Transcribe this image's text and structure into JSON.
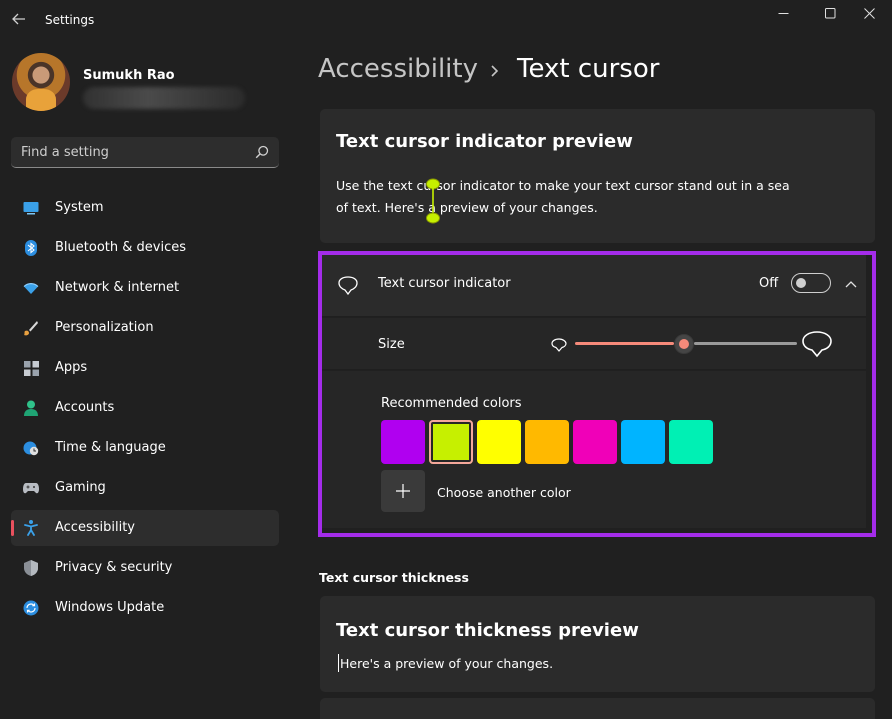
{
  "window": {
    "title": "Settings",
    "back_icon": "back-arrow-icon",
    "minimize_icon": "minimize-icon",
    "maximize_icon": "maximize-icon",
    "close_icon": "close-icon"
  },
  "profile": {
    "name": "Sumukh Rao"
  },
  "search": {
    "placeholder": "Find a setting",
    "value": "",
    "icon": "search-icon"
  },
  "sidebar": {
    "items": [
      {
        "label": "System",
        "icon": "system-icon",
        "active": false
      },
      {
        "label": "Bluetooth & devices",
        "icon": "bluetooth-icon",
        "active": false
      },
      {
        "label": "Network & internet",
        "icon": "wifi-icon",
        "active": false
      },
      {
        "label": "Personalization",
        "icon": "brush-icon",
        "active": false
      },
      {
        "label": "Apps",
        "icon": "apps-icon",
        "active": false
      },
      {
        "label": "Accounts",
        "icon": "person-icon",
        "active": false
      },
      {
        "label": "Time & language",
        "icon": "globe-clock-icon",
        "active": false
      },
      {
        "label": "Gaming",
        "icon": "gamepad-icon",
        "active": false
      },
      {
        "label": "Accessibility",
        "icon": "accessibility-icon",
        "active": true
      },
      {
        "label": "Privacy & security",
        "icon": "shield-icon",
        "active": false
      },
      {
        "label": "Windows Update",
        "icon": "update-icon",
        "active": false
      }
    ]
  },
  "breadcrumb": {
    "parent": "Accessibility",
    "current": "Text cursor"
  },
  "preview": {
    "title": "Text cursor indicator preview",
    "text": "Use the text cursor indicator to make your text cursor stand out in a sea of text. Here's a preview of your changes.",
    "cursor_color": "#c6f000"
  },
  "indicator": {
    "label": "Text cursor indicator",
    "state_label": "Off",
    "enabled": false,
    "expanded": true,
    "icon": "cursor-indicator-icon",
    "chevron_icon": "chevron-up-icon"
  },
  "size": {
    "label": "Size",
    "value_fraction": 0.49,
    "accent": "#f58a7a"
  },
  "colors": {
    "label": "Recommended colors",
    "swatches": [
      "#b000f0",
      "#c6f000",
      "#ffff00",
      "#ffb900",
      "#f000b8",
      "#00b4ff",
      "#00f0b4"
    ],
    "selected_index": 1,
    "add_label": "Choose another color",
    "add_icon": "plus-icon"
  },
  "thickness": {
    "section_heading": "Text cursor thickness",
    "preview_title": "Text cursor thickness preview",
    "preview_text": "Here's a preview of your changes."
  },
  "theme": {
    "highlight_border": "#a42cea",
    "active_marker": "#e9515e"
  }
}
